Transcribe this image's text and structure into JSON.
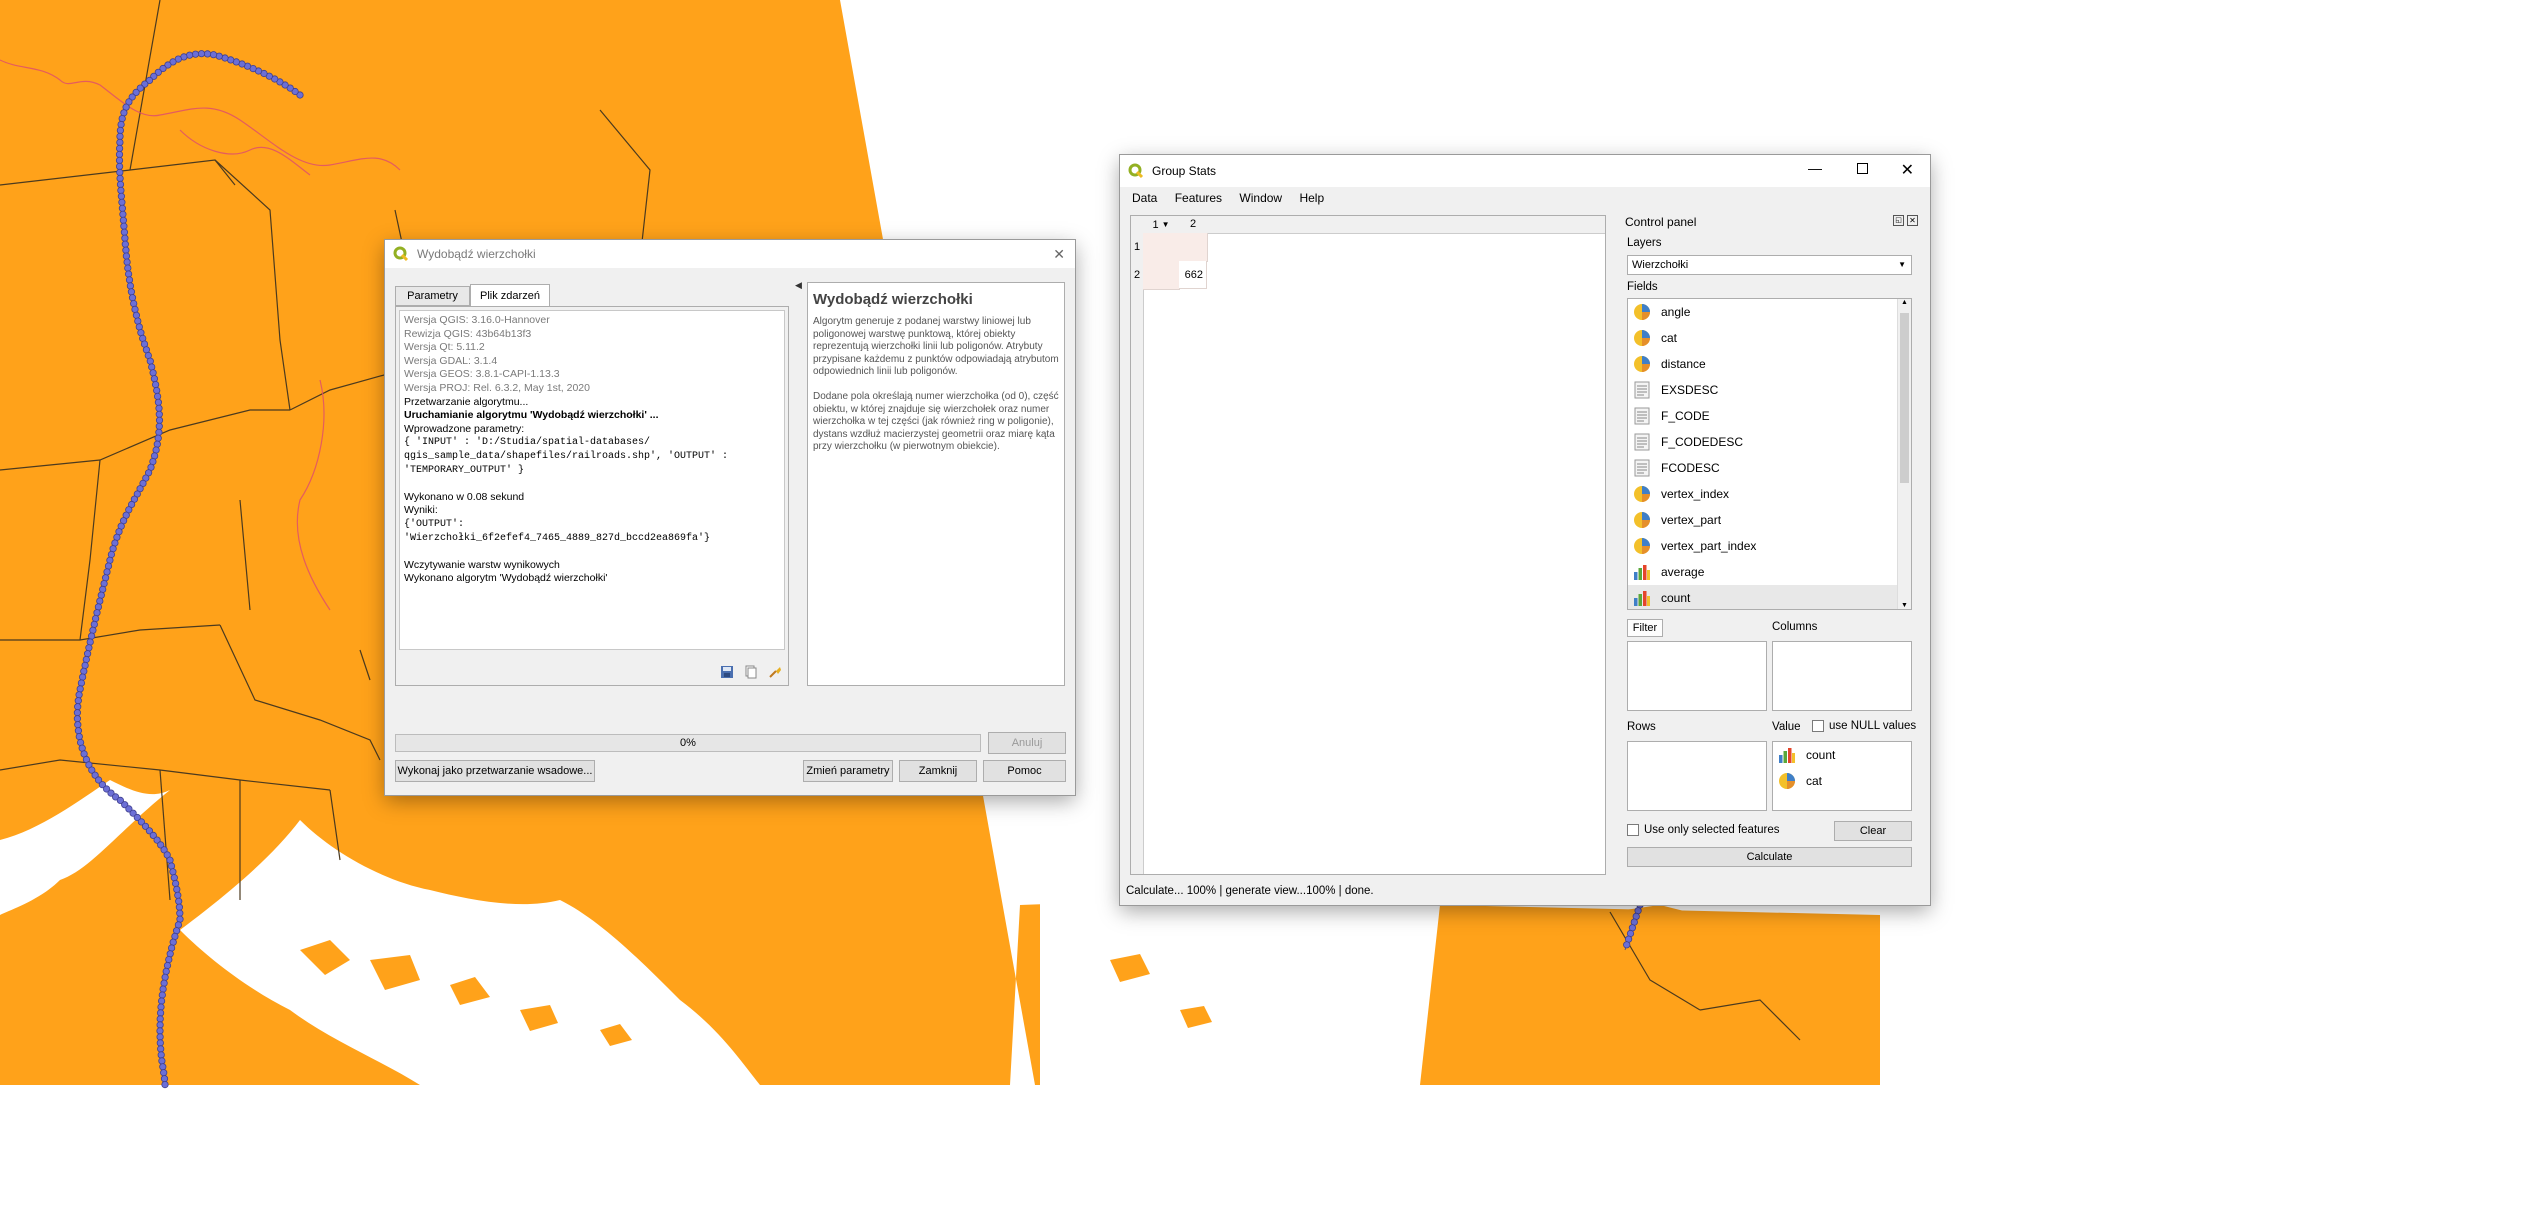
{
  "colors": {
    "map_fill": "#FFA21A",
    "map_border": "#4b3a1f",
    "water": "#ffffff",
    "railroad_points": "#6c6fd6",
    "river": "#e0506a",
    "progress_border": "#adadad"
  },
  "algo_dialog": {
    "title": "Wydobądź wierzchołki",
    "tabs": [
      "Parametry",
      "Plik zdarzeń"
    ],
    "log": {
      "grey_lines": [
        "Wersja QGIS: 3.16.0-Hannover",
        "Rewizja QGIS: 43b64b13f3",
        "Wersja Qt: 5.11.2",
        "Wersja GDAL: 3.1.4",
        "Wersja GEOS: 3.8.1-CAPI-1.13.3",
        "Wersja PROJ: Rel. 6.3.2, May 1st, 2020"
      ],
      "processing": "Przetwarzanie algorytmu...",
      "running": "Uruchamianie algorytmu 'Wydobądź wierzchołki' ...",
      "input_params_label": "Wprowadzone parametry:",
      "params_line1": "{ 'INPUT' : 'D:/Studia/spatial-databases/",
      "params_line2": "qgis_sample_data/shapefiles/railroads.shp', 'OUTPUT' :",
      "params_line3": "'TEMPORARY_OUTPUT' }",
      "done_time": "Wykonano w 0.08 sekund",
      "results_label": "Wyniki:",
      "result_line1": "{'OUTPUT':",
      "result_line2": "'Wierzchołki_6f2efef4_7465_4889_827d_bccd2ea869fa'}",
      "loading": "Wczytywanie warstw wynikowych",
      "finished": "Wykonano algorytm 'Wydobądź wierzchołki'"
    },
    "help": {
      "heading": "Wydobądź wierzchołki",
      "para1": "Algorytm generuje z podanej warstwy liniowej lub poligonowej warstwę punktową, której obiekty reprezentują wierzchołki linii lub poligonów. Atrybuty przypisane każdemu z punktów odpowiadają atrybutom odpowiednich linii lub poligonów.",
      "para2": "Dodane pola określają numer wierzchołka (od 0), część obiektu, w której znajduje się wierzchołek oraz numer wierzchołka w tej części (jak również ring w poligonie), dystans wzdłuż macierzystej geometrii oraz miarę kąta przy wierzchołku (w pierwotnym obiekcie)."
    },
    "progress_text": "0%",
    "progress_value": 0,
    "cancel_label": "Anuluj",
    "batch_label": "Wykonaj jako przetwarzanie wsadowe...",
    "change_params_label": "Zmień parametry",
    "close_label": "Zamknij",
    "help_label": "Pomoc"
  },
  "stats_window": {
    "title": "Group Stats",
    "menu": [
      "Data",
      "Features",
      "Window",
      "Help"
    ],
    "table": {
      "col_headers": [
        "1",
        "2"
      ],
      "row_headers": [
        "1",
        "2"
      ],
      "cells": [
        [
          "",
          ""
        ],
        [
          "",
          "662"
        ]
      ]
    },
    "status": "Calculate... 100% |  generate view...100% |  done.",
    "control_panel": {
      "title": "Control panel",
      "layers_label": "Layers",
      "layer_selected": "Wierzchołki",
      "fields_label": "Fields",
      "fields": [
        {
          "name": "angle",
          "icon": "numeric-pie-icon"
        },
        {
          "name": "cat",
          "icon": "numeric-pie-icon"
        },
        {
          "name": "distance",
          "icon": "numeric-pie-icon"
        },
        {
          "name": "EXSDESC",
          "icon": "text-field-icon"
        },
        {
          "name": "F_CODE",
          "icon": "text-field-icon"
        },
        {
          "name": "F_CODEDESC",
          "icon": "text-field-icon"
        },
        {
          "name": "FCODESC",
          "icon": "text-field-icon"
        },
        {
          "name": "vertex_index",
          "icon": "numeric-pie-icon"
        },
        {
          "name": "vertex_part",
          "icon": "numeric-pie-icon"
        },
        {
          "name": "vertex_part_index",
          "icon": "numeric-pie-icon"
        },
        {
          "name": "average",
          "icon": "bar-chart-icon"
        },
        {
          "name": "count",
          "icon": "bar-chart-icon"
        }
      ],
      "filter_label": "Filter",
      "columns_label": "Columns",
      "rows_label": "Rows",
      "value_label": "Value",
      "use_null_label": "use NULL values",
      "value_items": [
        {
          "name": "count",
          "icon": "bar-chart-icon"
        },
        {
          "name": "cat",
          "icon": "numeric-pie-icon"
        }
      ],
      "use_selected_label": "Use only selected features",
      "clear_label": "Clear",
      "calculate_label": "Calculate"
    }
  }
}
